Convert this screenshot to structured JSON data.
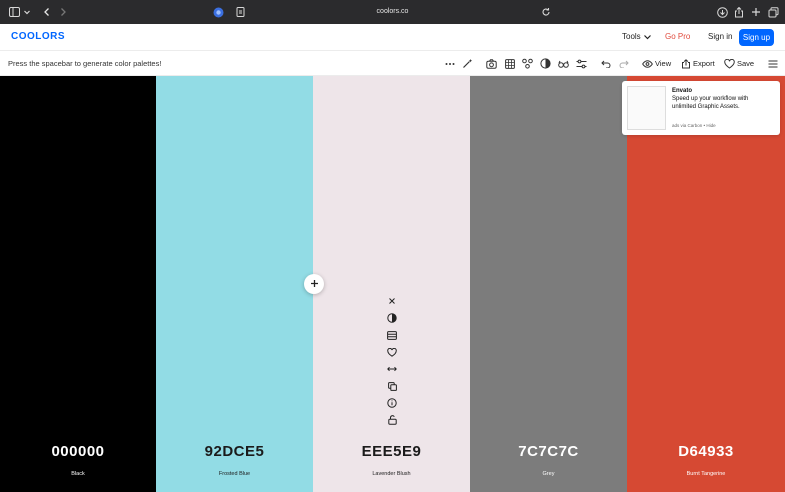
{
  "browser": {
    "url": "coolors.co",
    "icons": [
      "sidebar-icon",
      "chevron-down-icon",
      "back-icon",
      "forward-icon",
      "extension-icon",
      "page-icon",
      "reload-icon",
      "download-icon",
      "share-icon",
      "new-tab-icon",
      "tabs-icon"
    ]
  },
  "header": {
    "logo": "COOLORS",
    "tools_label": "Tools",
    "go_pro_label": "Go Pro",
    "sign_in_label": "Sign in",
    "sign_up_label": "Sign up",
    "colors": {
      "brand": "#0066ff",
      "go_pro": "#e14d3f"
    }
  },
  "toolbar": {
    "hint": "Press the spacebar to generate color palettes!",
    "view_label": "View",
    "export_label": "Export",
    "save_label": "Save"
  },
  "palette": [
    {
      "hex": "000000",
      "name": "Black",
      "color": "#000000",
      "text_color": "#ffffff"
    },
    {
      "hex": "92DCE5",
      "name": "Frosted Blue",
      "color": "#92DCE5",
      "text_color": "#1b1b1b"
    },
    {
      "hex": "EEE5E9",
      "name": "Lavender Blush",
      "color": "#EEE5E9",
      "text_color": "#1b1b1b"
    },
    {
      "hex": "7C7C7C",
      "name": "Grey",
      "color": "#7C7C7C",
      "text_color": "#ffffff"
    },
    {
      "hex": "D64933",
      "name": "Burnt Tangerine",
      "color": "#D64933",
      "text_color": "#ffffff"
    }
  ],
  "ad": {
    "title": "Envato",
    "body": "Speed up your workflow with unlimited Graphic Assets.",
    "footer": "ads via Carbon • Hide"
  }
}
